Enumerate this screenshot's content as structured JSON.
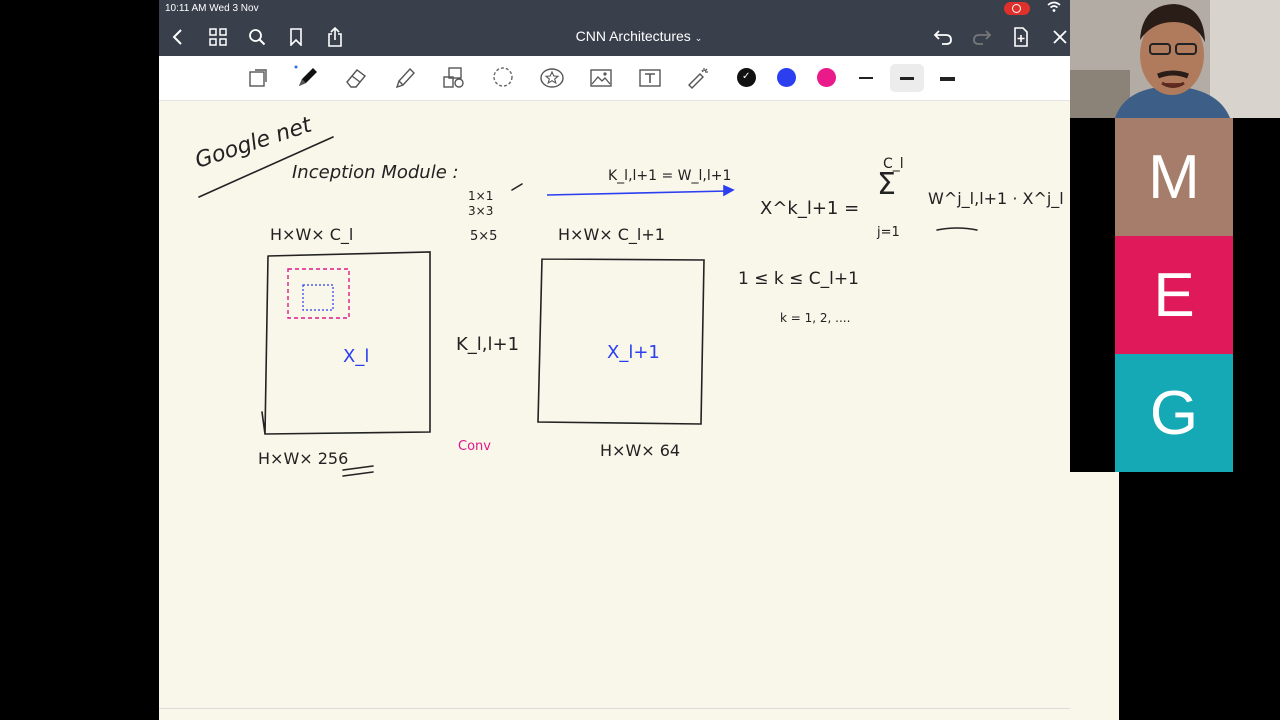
{
  "status_bar": {
    "time": "10:11 AM  Wed 3 Nov"
  },
  "nav": {
    "title": "CNN Architectures",
    "caret": "⌄"
  },
  "toolbar": {
    "colors": [
      "#111111",
      "#2b3ff0",
      "#ea1a8b"
    ],
    "selected_color": "#111111"
  },
  "notes": {
    "heading": "Google net",
    "subheading": "Inception Module :",
    "kernel_sizes": [
      "1×1",
      "3×3",
      "5×5"
    ],
    "input_dims": "H×W× C_l",
    "output_dims": "H×W× C_l+1",
    "input_label": "X_l",
    "output_label": "X_l+1",
    "kernel_label": "K_l,l+1",
    "conv_label": "Conv",
    "input_bottom": "H×W× 256",
    "output_bottom": "H×W× 64",
    "arrow_label": "K_l,l+1 = W_l,l+1",
    "equation_lhs": "X^k_l+1 =",
    "sum_top": "C_l",
    "sum_bottom": "j=1",
    "equation_rhs": "W^j_l,l+1 · X^j_l",
    "constraint": "1 ≤ k ≤ C_l+1",
    "k_values": "k = 1, 2, ...."
  },
  "participants": [
    {
      "initial": "M",
      "color": "#a57d6a"
    },
    {
      "initial": "E",
      "color": "#e0195a"
    },
    {
      "initial": "G",
      "color": "#15a8b5"
    }
  ]
}
